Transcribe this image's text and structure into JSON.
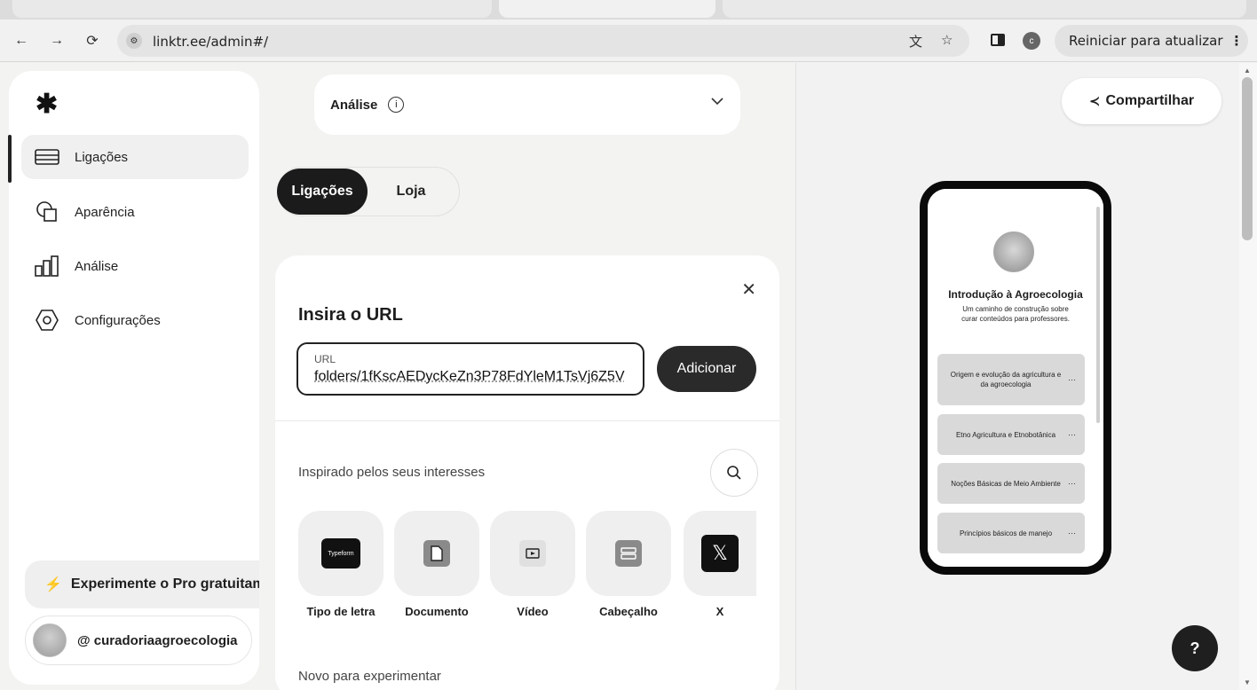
{
  "browser": {
    "url": "linktr.ee/admin#/",
    "restart_label": "Reiniciar para atualizar",
    "profile_initial": "c"
  },
  "sidebar": {
    "items": [
      {
        "label": "Ligações",
        "icon": "links-icon",
        "active": true
      },
      {
        "label": "Aparência",
        "icon": "appearance-icon",
        "active": false
      },
      {
        "label": "Análise",
        "icon": "analytics-icon",
        "active": false
      },
      {
        "label": "Configurações",
        "icon": "settings-icon",
        "active": false
      }
    ],
    "pro_label": "Experimente o Pro gratuitamente",
    "username": "@ curadoriaagroecologia"
  },
  "analytics_bar": {
    "label": "Análise"
  },
  "tabs": [
    "Ligações",
    "Loja"
  ],
  "modal": {
    "title": "Insira o URL",
    "url_label": "URL",
    "url_value": "folders/1fKscAEDycKeZn3P78FdYleM1TsVj6Z5V",
    "add_label": "Adicionar",
    "inspired_title": "Inspirado pelos seus interesses",
    "tiles": [
      {
        "label": "Tipo de letra",
        "icon": "typeform-icon"
      },
      {
        "label": "Documento",
        "icon": "document-icon"
      },
      {
        "label": "Vídeo",
        "icon": "video-icon"
      },
      {
        "label": "Cabeçalho",
        "icon": "header-icon"
      },
      {
        "label": "X",
        "icon": "x-logo-icon"
      }
    ],
    "new_title": "Novo para experimentar"
  },
  "preview": {
    "share_label": "Compartilhar",
    "profile_title": "Introdução à Agroecologia",
    "profile_desc": "Um caminho de construção sobre curar conteúdos para professores.",
    "links": [
      "Origem e evolução da agricultura e da agroecologia",
      "Etno Agricultura e Etnobotânica",
      "Noções Básicas de Meio Ambiente",
      "Princípios básicos de manejo"
    ]
  },
  "colors": {
    "accent_dark": "#1b1b1b",
    "page_bg": "#f3f3f1",
    "card_bg": "#ffffff"
  }
}
